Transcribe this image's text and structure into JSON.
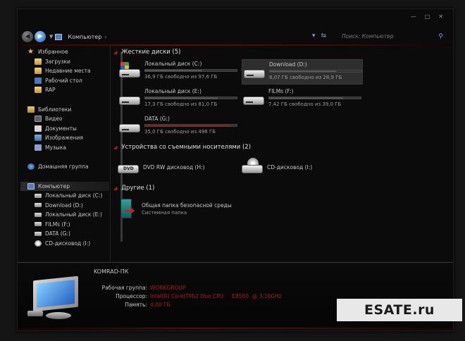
{
  "window": {
    "controls": [
      "—",
      "□",
      "✕"
    ]
  },
  "address": {
    "breadcrumb": "Компьютер",
    "search_placeholder": "Поиск: Компьютер"
  },
  "sidebar": {
    "favorites_title": "Избранное",
    "favorites": [
      "Загрузки",
      "Недавние места",
      "Рабочий стол",
      "RAP"
    ],
    "libraries_title": "Библиотеки",
    "libraries": [
      "Видео",
      "Документы",
      "Изображения",
      "Музыка"
    ],
    "homegroup": "Домашняя группа",
    "computer_title": "Компьютер",
    "computer_items": [
      "Локальный диск (C:)",
      "Download (D:)",
      "Локальный диск (E:)",
      "FILMs (F:)",
      "DATA (G:)",
      "CD-дисковод (I:)"
    ]
  },
  "hard_drives": {
    "title": "Жесткие диски (5)",
    "items": [
      {
        "name": "Локальный диск (C:)",
        "free": "36,9 ГБ свободно из 97,6 ГБ",
        "used_fraction": 0.62,
        "warn": false
      },
      {
        "name": "Download (D:)",
        "free": "8,07 ГБ свободно из 28,9 ГБ",
        "used_fraction": 0.72,
        "warn": false
      },
      {
        "name": "Локальный диск (E:)",
        "free": "17,3 ГБ свободно из 81,0 ГБ",
        "used_fraction": 0.79,
        "warn": false
      },
      {
        "name": "FILMs (F:)",
        "free": "7,42 ГБ свободно из 39,0 ГБ",
        "used_fraction": 0.81,
        "warn": false
      },
      {
        "name": "DATA (G:)",
        "free": "35,0 ГБ свободно из 498 ГБ",
        "used_fraction": 0.93,
        "warn": true
      }
    ]
  },
  "removable": {
    "title": "Устройства со съемными носителями (2)",
    "items": [
      {
        "name": "DVD RW дисковод (H:)",
        "icon_label": "DVD"
      },
      {
        "name": "CD-дисковод (I:)"
      }
    ]
  },
  "other": {
    "title": "Другие (1)",
    "item_name": "Общая папка безопасной среды",
    "item_type": "Системная папка"
  },
  "details": {
    "computer_name": "KOMRAD-ПК",
    "workgroup_label": "Рабочая группа:",
    "workgroup_value": "WORKGROUP",
    "cpu_label": "Процессор:",
    "cpu_value": "Intel(R) Core(TM)2 Duo CPU     E8500  @ 3.16GHz",
    "memory_label": "Память:",
    "memory_value": "4,00 ГБ"
  },
  "watermark": "ESATE.ru",
  "colors": {
    "accent_red": "#b01818",
    "background": "#0b0b0b"
  }
}
